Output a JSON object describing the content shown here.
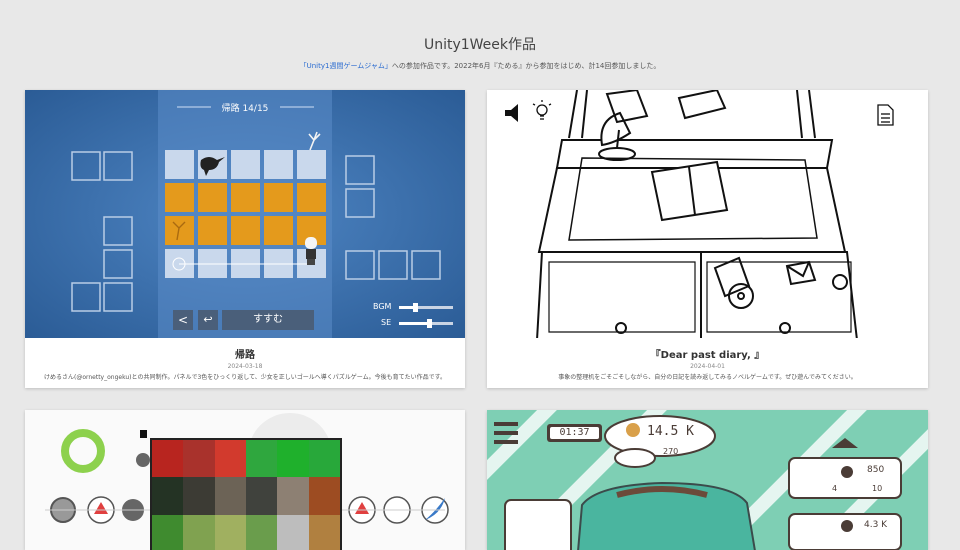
{
  "page": {
    "title": "Unity1Week作品",
    "intro_link": "「Unity1週間ゲームジャム」",
    "intro_text": "への参加作品です。2022年6月『ためる』から参加をはじめ、計14回参加しました。"
  },
  "games": [
    {
      "title": "帰路",
      "date": "2024-03-18",
      "description": "けめるさん(@ornetty_ongeku)との共同制作。パネルで3色をひっくり返して、少女を正しいゴールへ導くパズルゲーム。今後も育てたい作品です。",
      "screen": {
        "stage_label": "帰路 14/15",
        "next_button": "すすむ",
        "back_button": "<",
        "undo_button": "↩",
        "bgm_label": "BGM",
        "se_label": "SE",
        "bgm_level": 0.3,
        "se_level": 0.55
      }
    },
    {
      "title": "『Dear past diary, 』",
      "date": "2024-04-01",
      "description": "事象の整理机をごそごそしながら、自分の日記を読み返してみるノベルゲームです。ぜひ遊んでみてください。",
      "screen": {}
    },
    {
      "title": "",
      "date": "",
      "description": "",
      "screen": {}
    },
    {
      "title": "",
      "date": "",
      "description": "",
      "screen": {
        "timer": "01:37",
        "money": "14.5 K",
        "fans": "270",
        "item1_price": "850",
        "item1_qty_left": "4",
        "item1_qty_right": "10",
        "item2_price": "4.3 K"
      }
    }
  ],
  "colors": {
    "background": "#e8e8e8",
    "link": "#2a6bd0",
    "kiro_blue": "#3c70ad",
    "kiro_orange": "#e49a1c",
    "teal": "#7ecfb4"
  }
}
